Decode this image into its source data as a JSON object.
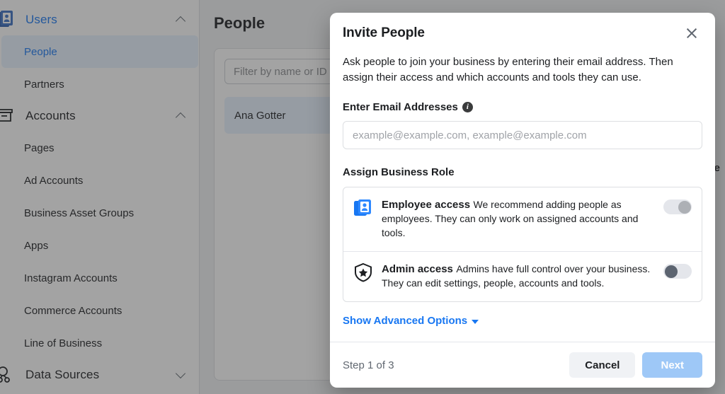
{
  "sidebar": {
    "groups": [
      {
        "label": "Users",
        "icon": "id-badge-icon",
        "chevron": "chevron-up-icon",
        "active": true,
        "items": [
          {
            "label": "People",
            "selected": true
          },
          {
            "label": "Partners",
            "selected": false
          }
        ]
      },
      {
        "label": "Accounts",
        "icon": "archive-box-icon",
        "chevron": "chevron-up-icon",
        "active": false,
        "items": [
          {
            "label": "Pages",
            "selected": false
          },
          {
            "label": "Ad Accounts",
            "selected": false
          },
          {
            "label": "Business Asset Groups",
            "selected": false
          },
          {
            "label": "Apps",
            "selected": false
          },
          {
            "label": "Instagram Accounts",
            "selected": false
          },
          {
            "label": "Commerce Accounts",
            "selected": false
          },
          {
            "label": "Line of Business",
            "selected": false
          }
        ]
      },
      {
        "label": "Data Sources",
        "icon": "data-nodes-icon",
        "chevron": "chevron-down-icon",
        "active": false,
        "items": []
      }
    ]
  },
  "page": {
    "title": "People",
    "filter_placeholder": "Filter by name or ID",
    "person_name": "Ana Gotter",
    "partial_column_header": "ce"
  },
  "modal": {
    "title": "Invite People",
    "close_icon": "close-icon",
    "description": "Ask people to join your business by entering their email address. Then assign their access and which accounts and tools they can use.",
    "email_label": "Enter Email Addresses",
    "email_info_icon": "info-icon",
    "email_value": "",
    "email_placeholder": "example@example.com, example@example.com",
    "role_section_label": "Assign Business Role",
    "roles": [
      {
        "name": "Employee access",
        "description": "We recommend adding people as employees. They can only work on assigned accounts and tools.",
        "icon": "id-badge-icon",
        "toggle_state": "right",
        "enabled": false
      },
      {
        "name": "Admin access",
        "description": "Admins have full control over your business. They can edit settings, people, accounts and tools.",
        "icon": "shield-star-icon",
        "toggle_state": "left",
        "enabled": false
      }
    ],
    "advanced_link": "Show Advanced Options",
    "advanced_caret_icon": "caret-down-icon",
    "step_text": "Step 1 of 3",
    "cancel_label": "Cancel",
    "next_label": "Next"
  },
  "colors": {
    "brand_blue": "#1877f2",
    "next_button": "#9ec8f7",
    "selected_row": "#e7f3ff",
    "page_bg": "#f0f2f5"
  }
}
